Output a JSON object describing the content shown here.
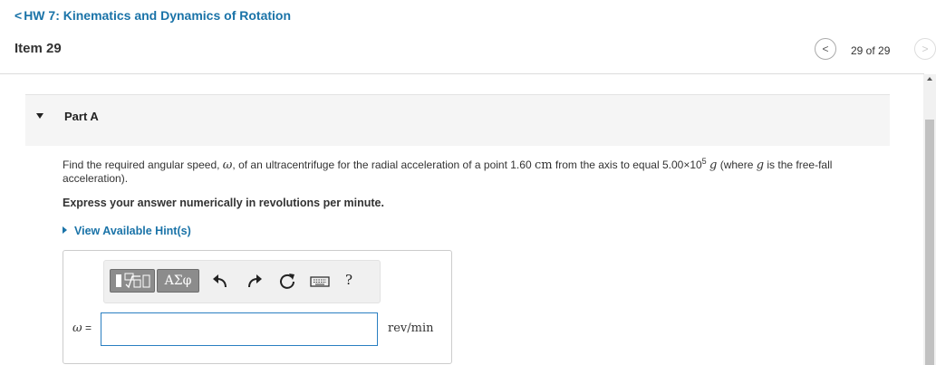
{
  "header": {
    "back_chevron": "<",
    "assignment_title": "HW 7: Kinematics and Dynamics of Rotation",
    "item_title": "Item 29"
  },
  "pager": {
    "prev_icon": "chevron-left-icon",
    "next_icon": "chevron-right-icon",
    "prev_glyph": "<",
    "next_glyph": ">",
    "position_text": "29 of 29"
  },
  "part": {
    "label": "Part A",
    "question": {
      "t1": "Find the required angular speed, ",
      "omega": "ω",
      "t2": ", of an ultracentrifuge for the radial acceleration of a point 1.60 ",
      "cm": "cm",
      "t3": " from the axis to equal 5.00×10",
      "exp": "5",
      "t4": " ",
      "g1": "g",
      "t5": " (where ",
      "g2": "g",
      "t6": " is the free-fall acceleration)."
    },
    "instruction": "Express your answer numerically in revolutions per minute.",
    "hint_link": "View Available Hint(s)"
  },
  "answer": {
    "toolbar": {
      "templates_icon": "templates-icon",
      "greek_label": "ΑΣφ",
      "undo_icon": "undo-icon",
      "redo_icon": "redo-icon",
      "reset_icon": "reset-icon",
      "keyboard_icon": "keyboard-icon",
      "help_label": "?"
    },
    "variable": "ω",
    "equals": " =",
    "value": "",
    "unit": "rev/min"
  },
  "colors": {
    "link": "#1a73a8",
    "input_border": "#2a7fc1",
    "toolbar_button": "#8c8c8c",
    "panel_bg": "#f5f5f5"
  }
}
